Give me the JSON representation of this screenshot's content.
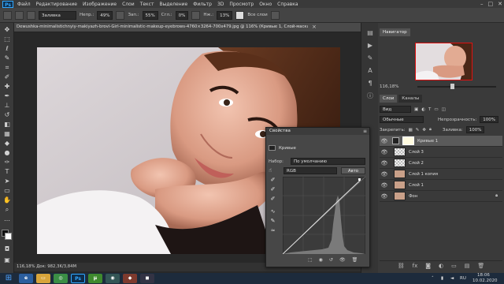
{
  "menu": {
    "items": [
      "Файл",
      "Редактирование",
      "Изображение",
      "Слои",
      "Текст",
      "Выделение",
      "Фильтр",
      "3D",
      "Просмотр",
      "Окно",
      "Справка"
    ],
    "logo": "Ps"
  },
  "options": {
    "mode_value": "Заливка",
    "opacity_label": "Непр.:",
    "opacity_value": "49%",
    "press_label": "Зап.:",
    "press_value": "55%",
    "smooth_label": "Сгл.:",
    "smooth_value": "0%",
    "flow_label": "Нж.:",
    "flow_value": "13%",
    "all_layers_label": "Все слои"
  },
  "document": {
    "tab_title": "Dewushka-minimalistichnyiy-makiyazh-brovi-Girl-minimalistic-makeup-eyebrows-4760×3264-700x479.jpg @ 116% (Кривые 1, Слой-маска/8) *",
    "status_text": "116,18%   Док: 982,3K/3,84M"
  },
  "navigator": {
    "tab_label": "Навигатор",
    "zoom_value": "116,18%"
  },
  "layers": {
    "tabs": [
      "Слои",
      "Каналы"
    ],
    "kind_value": "Вид",
    "blend_value": "Обычные",
    "opacity_label": "Непрозрачность:",
    "opacity_value": "100%",
    "lock_label": "Закрепить:",
    "fill_label": "Заливка:",
    "fill_value": "100%",
    "items": [
      {
        "name": "Кривые 1"
      },
      {
        "name": "Слой 3"
      },
      {
        "name": "Слой 2"
      },
      {
        "name": "Слой 1 копия"
      },
      {
        "name": "Слой 1"
      },
      {
        "name": "Фон"
      }
    ]
  },
  "properties": {
    "title": "Свойства",
    "subtitle": "Кривые",
    "preset_label": "Набор:",
    "preset_value": "По умолчанию",
    "channel_value": "RGB",
    "auto_label": "Авто"
  },
  "taskbar": {
    "language": "RU",
    "time": "18:06",
    "date": "10.02.2020"
  },
  "colors": {
    "selection_border": "#dd1111",
    "accent": "#31a8ff"
  }
}
